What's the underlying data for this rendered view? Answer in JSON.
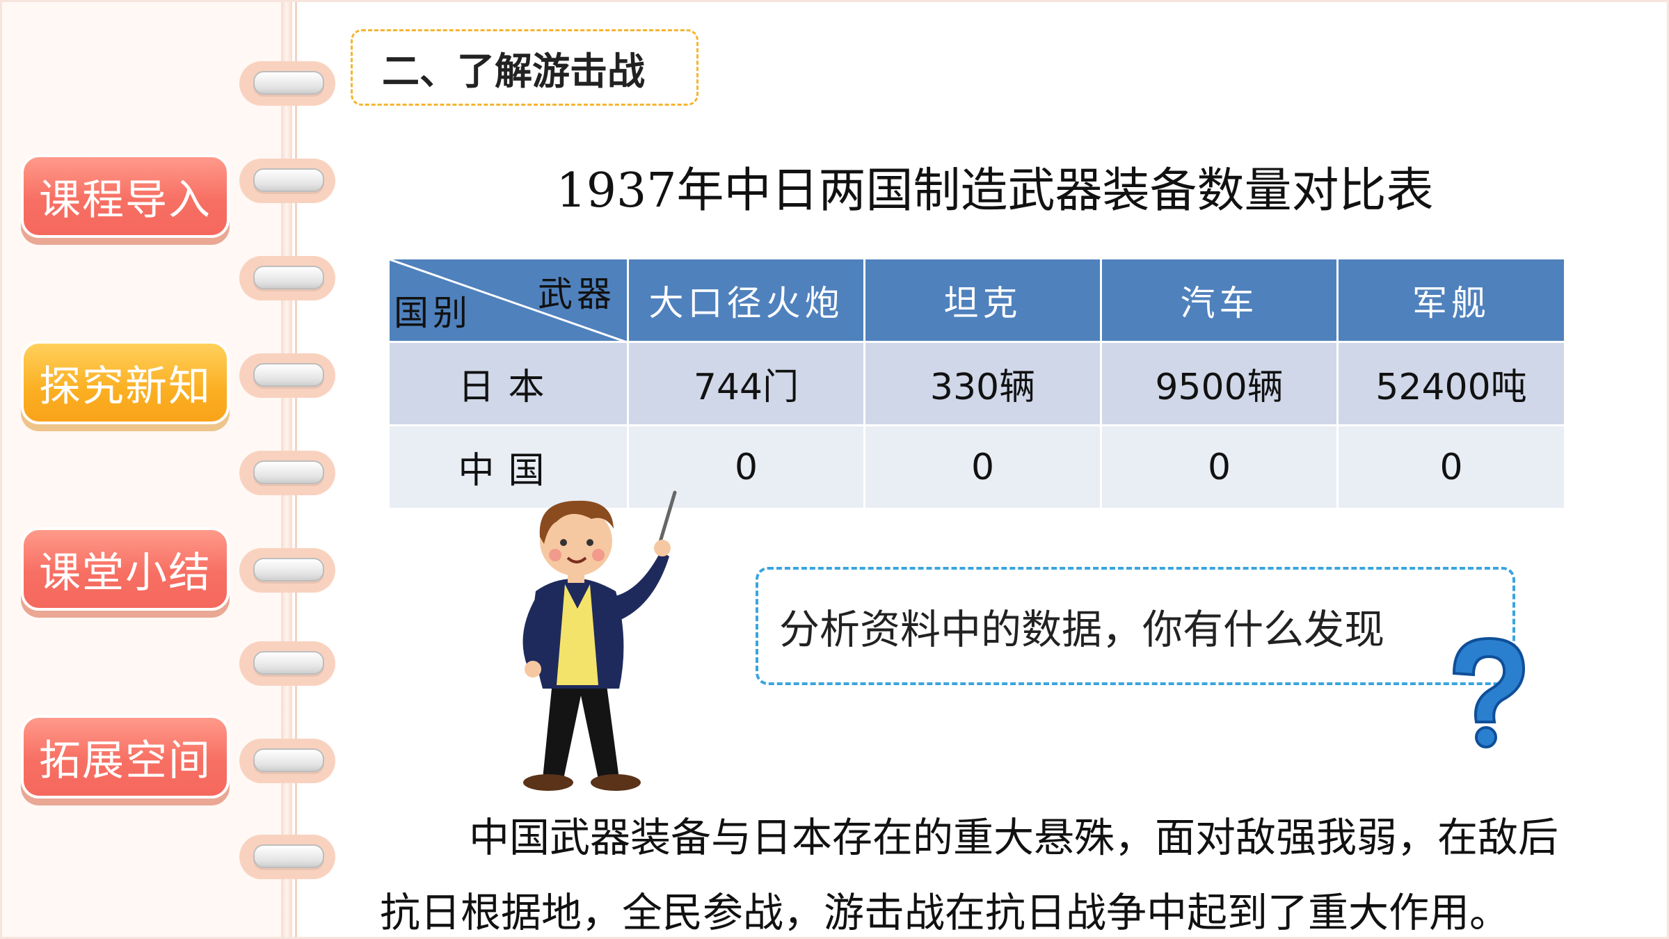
{
  "sidebar": {
    "items": [
      {
        "label": "课程导入"
      },
      {
        "label": "探究新知"
      },
      {
        "label": "课堂小结"
      },
      {
        "label": "拓展空间"
      }
    ]
  },
  "section": {
    "label": "二、了解游击战"
  },
  "table": {
    "title": "1937年中日两国制造武器装备数量对比表",
    "corner_top": "武器",
    "corner_bottom": "国别",
    "headers": [
      "大口径火炮",
      "坦克",
      "汽车",
      "军舰"
    ],
    "rows": [
      {
        "country": "日本",
        "values": [
          "744门",
          "330辆",
          "9500辆",
          "52400吨"
        ]
      },
      {
        "country": "中国",
        "values": [
          "0",
          "0",
          "0",
          "0"
        ]
      }
    ]
  },
  "question": {
    "text": "分析资料中的数据，你有什么发现"
  },
  "summary": {
    "text": "中国武器装备与日本存在的重大悬殊，面对敌强我弱，在敌后抗日根据地，全民参战，游击战在抗日战争中起到了重大作用。"
  },
  "colors": {
    "header_blue": "#4f81bd",
    "row_light": "#cfd7e8",
    "nav_red": "#f76f63",
    "nav_orange": "#fbaf22",
    "dash_orange": "#f5b52f",
    "dash_blue": "#3aa4de"
  },
  "icons": {
    "teacher": "teacher-pointer-illustration",
    "question": "question-mark-icon"
  }
}
